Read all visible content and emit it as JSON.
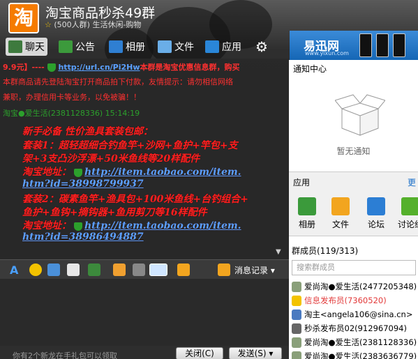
{
  "header": {
    "title": "淘宝商品秒杀49群",
    "subtitle": "(500人群) 生活休闲-购物",
    "logo_text": "淘"
  },
  "tabs": [
    {
      "label": "聊天",
      "icon": "chat-icon",
      "selected": true
    },
    {
      "label": "公告",
      "icon": "announcement-icon"
    },
    {
      "label": "相册",
      "icon": "album-icon"
    },
    {
      "label": "文件",
      "icon": "folder-icon"
    },
    {
      "label": "应用",
      "icon": "apps-icon"
    },
    {
      "label": "",
      "icon": "gear-icon"
    }
  ],
  "ad": {
    "logo": "易迅网",
    "url": "www.yixun.com"
  },
  "chat": {
    "line1_prefix": "9.9元】----",
    "line1_link": "http://url.cn/Pi2",
    "line1_link2": "Hw",
    "line1_suffix": "本群是淘宝优惠信息群，购买",
    "line2": "本群商品请先登陆淘宝打开商品拍下付款，友情提示：请勿相信网络",
    "line3": "兼职，办理信用卡等业务，以免被骗！！",
    "line4": "淘宝●爱生活(2381128336) 15:14:19",
    "msg_title": "新手必备 性价渔具套装包邮：",
    "set1_a": "套装1：超轻超细合钓鱼竿+沙网+鱼护+竿包+支",
    "set1_b": "架+3支凸沙浮漂+50米鱼线等20样配件",
    "addr_label": "淘宝地址：",
    "link1_a": "http://item.taobao.com/item.",
    "link1_b": "htm?id=38998799937",
    "set2_a": "套装2：碳素鱼竿+渔具包+100米鱼线+台钓组合+",
    "set2_b": "鱼护+鱼钩+摘钩器+鱼用剪刀等16样配件",
    "link2_a": "http://item.taobao.com/item.",
    "link2_b": "htm?id=38986494887"
  },
  "input_bar": {
    "history_label": "消息记录"
  },
  "bottom": {
    "notice": "你有2个新龙在手礼包可以领取",
    "close_label": "关闭(C)",
    "send_label": "发送(S)"
  },
  "notice_center": {
    "title": "通知中心",
    "empty": "暂无通知"
  },
  "apps": {
    "title": "应用",
    "more": "更",
    "items": [
      {
        "label": "相册",
        "icon": "album-icon",
        "color": "#3b9a3b"
      },
      {
        "label": "文件",
        "icon": "folder-icon",
        "color": "#f2a51f"
      },
      {
        "label": "论坛",
        "icon": "forum-icon",
        "color": "#2c7ed4"
      },
      {
        "label": "讨论组",
        "icon": "discussion-icon",
        "color": "#55b02c"
      }
    ]
  },
  "members": {
    "title": "群成员(119/313)",
    "search_placeholder": "搜索群成员",
    "list": [
      {
        "name": "爱尚淘●爱生活(2477205348)",
        "color": "#000000"
      },
      {
        "name": "信息发布员(7360520)",
        "color": "#e23a3a"
      },
      {
        "name": "淘主<angela106@sina.cn>",
        "color": "#000000"
      },
      {
        "name": "秒杀发布员02(912967094)",
        "color": "#000000"
      },
      {
        "name": "爱尚淘●爱生活(2381128336)",
        "color": "#000000"
      },
      {
        "name": "爱尚淘●爱生活(2383636779)",
        "color": "#000000"
      }
    ]
  }
}
